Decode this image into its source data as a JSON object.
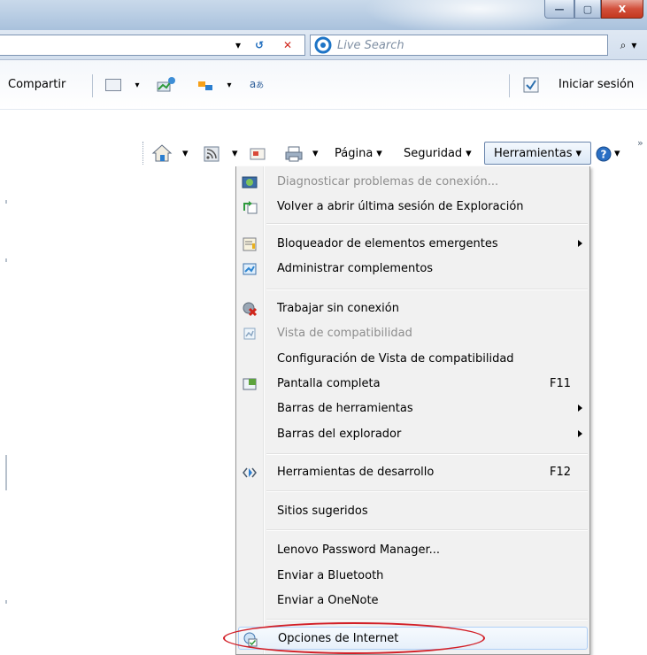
{
  "window": {
    "controls": {
      "minimize": "—",
      "maximize": "▢",
      "close": "X"
    }
  },
  "address_bar": {
    "dropdown_glyph": "▾",
    "refresh_glyph": "↺",
    "stop_glyph": "✕"
  },
  "search": {
    "placeholder": "Live Search",
    "go_glyph": "⌕",
    "options_glyph": "▾"
  },
  "favorites_bar": {
    "share_label": "Compartir",
    "sign_in_label": "Iniciar sesión"
  },
  "command_bar": {
    "page_label": "Página",
    "security_label": "Seguridad",
    "tools_label": "Herramientas",
    "dropdown_glyph": "▾",
    "overflow_glyph": "»"
  },
  "tools_menu": {
    "items": [
      {
        "label": "Diagnosticar problemas de conexión...",
        "icon": "network-diagnose-icon",
        "disabled": true
      },
      {
        "label": "Volver a abrir última sesión de Exploración",
        "icon": "reopen-session-icon"
      },
      {
        "label": "Bloqueador de elementos emergentes",
        "icon": "popup-blocker-icon",
        "submenu": true
      },
      {
        "label": "Administrar complementos",
        "icon": "addons-icon"
      },
      {
        "label": "Trabajar sin conexión",
        "icon": "offline-icon"
      },
      {
        "label": "Vista de compatibilidad",
        "icon": "compat-view-icon",
        "disabled": true
      },
      {
        "label": "Configuración de Vista de compatibilidad"
      },
      {
        "label": "Pantalla completa",
        "icon": "fullscreen-icon",
        "shortcut": "F11"
      },
      {
        "label": "Barras de herramientas",
        "submenu": true
      },
      {
        "label": "Barras del explorador",
        "submenu": true
      },
      {
        "label": "Herramientas de desarrollo",
        "icon": "developer-tools-icon",
        "shortcut": "F12"
      },
      {
        "label": "Sitios sugeridos"
      },
      {
        "label": "Lenovo Password Manager..."
      },
      {
        "label": "Enviar a Bluetooth"
      },
      {
        "label": "Enviar a OneNote"
      },
      {
        "label": "Opciones de Internet",
        "icon": "internet-options-icon",
        "highlighted": true
      }
    ]
  },
  "colors": {
    "highlight_oval": "#d21f27",
    "menu_background": "#f1f1f1",
    "disabled_text": "#8d8d8d"
  }
}
